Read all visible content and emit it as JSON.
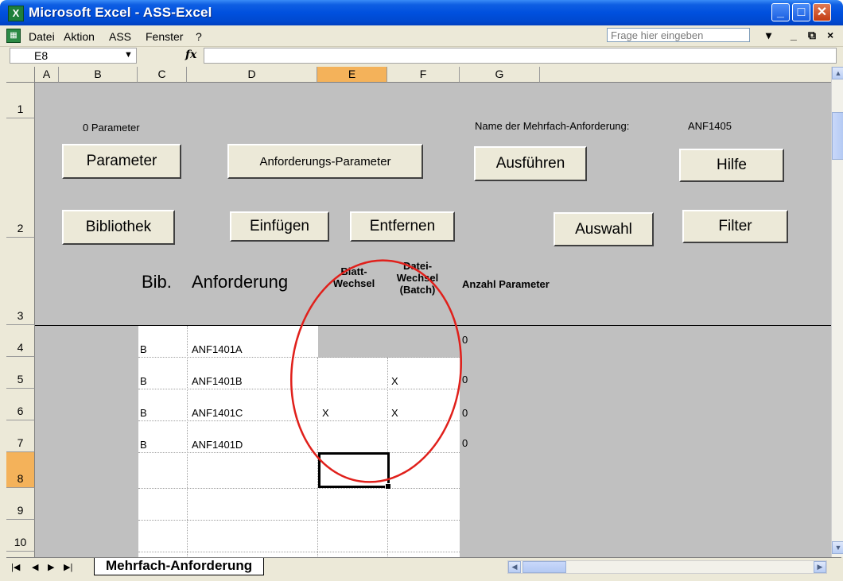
{
  "window": {
    "title": "Microsoft Excel - ASS-Excel"
  },
  "menu": {
    "items": [
      "Datei",
      "Aktion",
      "ASS",
      "Fenster",
      "?"
    ],
    "help_placeholder": "Frage hier eingeben"
  },
  "formula_bar": {
    "name_box": "E8",
    "fx_label": "fx",
    "formula": ""
  },
  "columns": [
    "A",
    "B",
    "C",
    "D",
    "E",
    "F",
    "G"
  ],
  "selected_column": "E",
  "rows": [
    "1",
    "2",
    "3",
    "4",
    "5",
    "6",
    "7",
    "8",
    "9",
    "10"
  ],
  "selected_row": "8",
  "sheet": {
    "param_count": "0 Parameter",
    "name_label": "Name der Mehrfach-Anforderung:",
    "name_value": "ANF1405",
    "buttons": {
      "parameter": "Parameter",
      "anf_param": "Anforderungs-Parameter",
      "ausfuehren": "Ausführen",
      "hilfe": "Hilfe",
      "bibliothek": "Bibliothek",
      "einfuegen": "Einfügen",
      "entfernen": "Entfernen",
      "auswahl": "Auswahl",
      "filter": "Filter"
    },
    "headers": {
      "bib": "Bib.",
      "anforderung": "Anforderung",
      "blatt_1": "Blatt-",
      "blatt_2": "Wechsel",
      "datei_1": "Datei-",
      "datei_2": "Wechsel",
      "datei_3": "(Batch)",
      "anzahl": "Anzahl Parameter"
    },
    "table_rows": [
      {
        "bib": "B",
        "name": "ANF1401A",
        "blatt": "",
        "datei": "",
        "anzahl": "0"
      },
      {
        "bib": "B",
        "name": "ANF1401B",
        "blatt": "",
        "datei": "X",
        "anzahl": "0"
      },
      {
        "bib": "B",
        "name": "ANF1401C",
        "blatt": "X",
        "datei": "X",
        "anzahl": "0"
      },
      {
        "bib": "B",
        "name": "ANF1401D",
        "blatt": "",
        "datei": "",
        "anzahl": "0"
      }
    ]
  },
  "sheet_tabs": [
    "Mehrfach-Anforderung"
  ],
  "colors": {
    "title_bar": "#0050de",
    "selected_header": "#f4b25a",
    "annotation": "#e0201b",
    "sheet_gray": "#c0c0c0"
  },
  "icons": [
    "excel-icon",
    "minimize-icon",
    "maximize-icon",
    "close-icon",
    "dropdown-arrow-icon",
    "fx-icon"
  ]
}
